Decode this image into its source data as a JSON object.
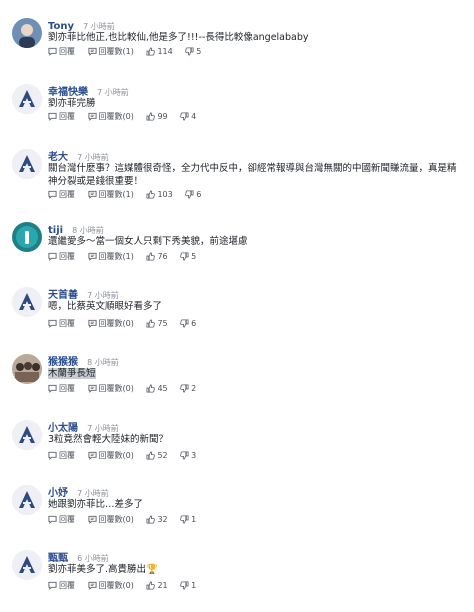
{
  "labels": {
    "reply": "回覆",
    "reply_count": "回覆數"
  },
  "colors": {
    "username": "#2b4d8e",
    "avatar_mark": "#2f4a82"
  },
  "comments": [
    {
      "user": "Tony",
      "time": "7 小時前",
      "text": "劉亦菲比他正,也比較仙,他是多了!!!--長得比較像angelababy",
      "likes": "114",
      "dislikes": "5",
      "reply": "回覆",
      "reply_count": "回覆數(1)",
      "avatar": "photo"
    },
    {
      "user": "幸福快樂",
      "time": "7 小時前",
      "text": "劉亦菲完勝",
      "likes": "99",
      "dislikes": "4",
      "reply": "回覆",
      "reply_count": "回覆數(0)",
      "avatar": "logo"
    },
    {
      "user": "老大",
      "time": "7 小時前",
      "text": "關台灣什麼事？這媒體很奇怪，全力代中反中，卻經常報導與台灣無關的中國新聞賺流量，真是精神分裂或是錢很重要！",
      "likes": "103",
      "dislikes": "6",
      "reply": "回覆",
      "reply_count": "回覆數(1)",
      "avatar": "logo"
    },
    {
      "user": "tiji",
      "time": "8 小時前",
      "text": "還繼愛多～當一個女人只剩下秀美貌，前途堪慮",
      "likes": "76",
      "dislikes": "5",
      "reply": "回覆",
      "reply_count": "回覆數(1)",
      "avatar": "teal"
    },
    {
      "user": "天首善",
      "time": "7 小時前",
      "text": "嗯，比蔡英文順眼好看多了",
      "likes": "75",
      "dislikes": "6",
      "reply": "回覆",
      "reply_count": "回覆數(0)",
      "avatar": "logo"
    },
    {
      "user": "猴猴猴",
      "time": "8 小時前",
      "text": "木蘭爭長短",
      "likes": "45",
      "dislikes": "2",
      "reply": "回覆",
      "reply_count": "回覆數(0)",
      "avatar": "photo2",
      "highlight": true
    },
    {
      "user": "小太陽",
      "time": "7 小時前",
      "text": "3粒竟然會輕大陸妹的新聞？",
      "likes": "52",
      "dislikes": "3",
      "reply": "回覆",
      "reply_count": "回覆數(0)",
      "avatar": "logo"
    },
    {
      "user": "小妤",
      "time": "7 小時前",
      "text": "她跟劉亦菲比…差多了",
      "likes": "32",
      "dislikes": "1",
      "reply": "回覆",
      "reply_count": "回覆數(0)",
      "avatar": "logo"
    },
    {
      "user": "甄甄",
      "time": "6 小時前",
      "text": "劉亦菲美多了.高貴勝出🏆",
      "likes": "21",
      "dislikes": "1",
      "reply": "回覆",
      "reply_count": "回覆數(0)",
      "avatar": "logo"
    }
  ]
}
